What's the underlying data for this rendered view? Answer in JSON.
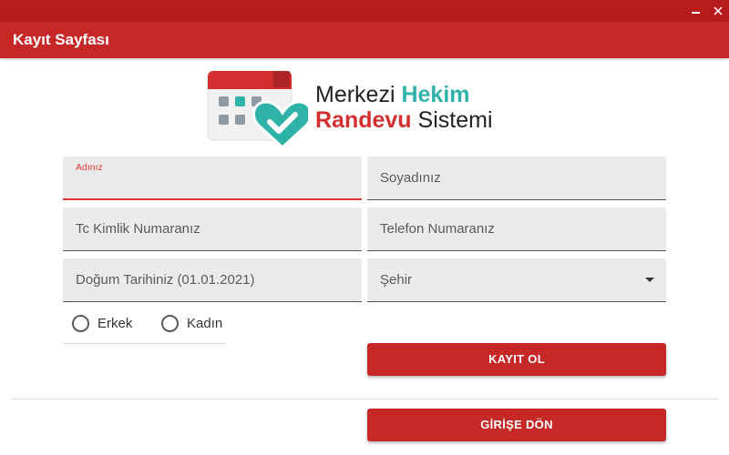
{
  "window": {
    "title_bar_color": "#b71c1c",
    "minimize_icon": "minimize-icon",
    "close_icon": "close-icon"
  },
  "header": {
    "title": "Kayıt Sayfası",
    "color": "#c62828"
  },
  "logo": {
    "line1_part1": "Merkezi ",
    "line1_part2": "Hekim",
    "line2_part1": "Randevu",
    "line2_part2": " Sistemi",
    "icon": "calendar-heart-check-icon",
    "accent_teal": "#2fb3a8",
    "accent_red": "#d32f2f"
  },
  "form": {
    "first_name": {
      "label": "Adınız",
      "value": ""
    },
    "last_name": {
      "placeholder": "Soyadınız"
    },
    "tc_number": {
      "placeholder": "Tc Kimlik Numaranız"
    },
    "phone": {
      "placeholder": "Telefon Numaranız"
    },
    "birth_date": {
      "placeholder": "Doğum Tarihiniz (01.01.2021)"
    },
    "city": {
      "selected": "Şehir",
      "icon": "chevron-down-icon"
    },
    "gender": {
      "options": [
        {
          "label": "Erkek",
          "selected": false
        },
        {
          "label": "Kadın",
          "selected": false
        }
      ]
    }
  },
  "buttons": {
    "register": "KAYIT OL",
    "back_to_login": "GİRİŞE DÖN"
  }
}
